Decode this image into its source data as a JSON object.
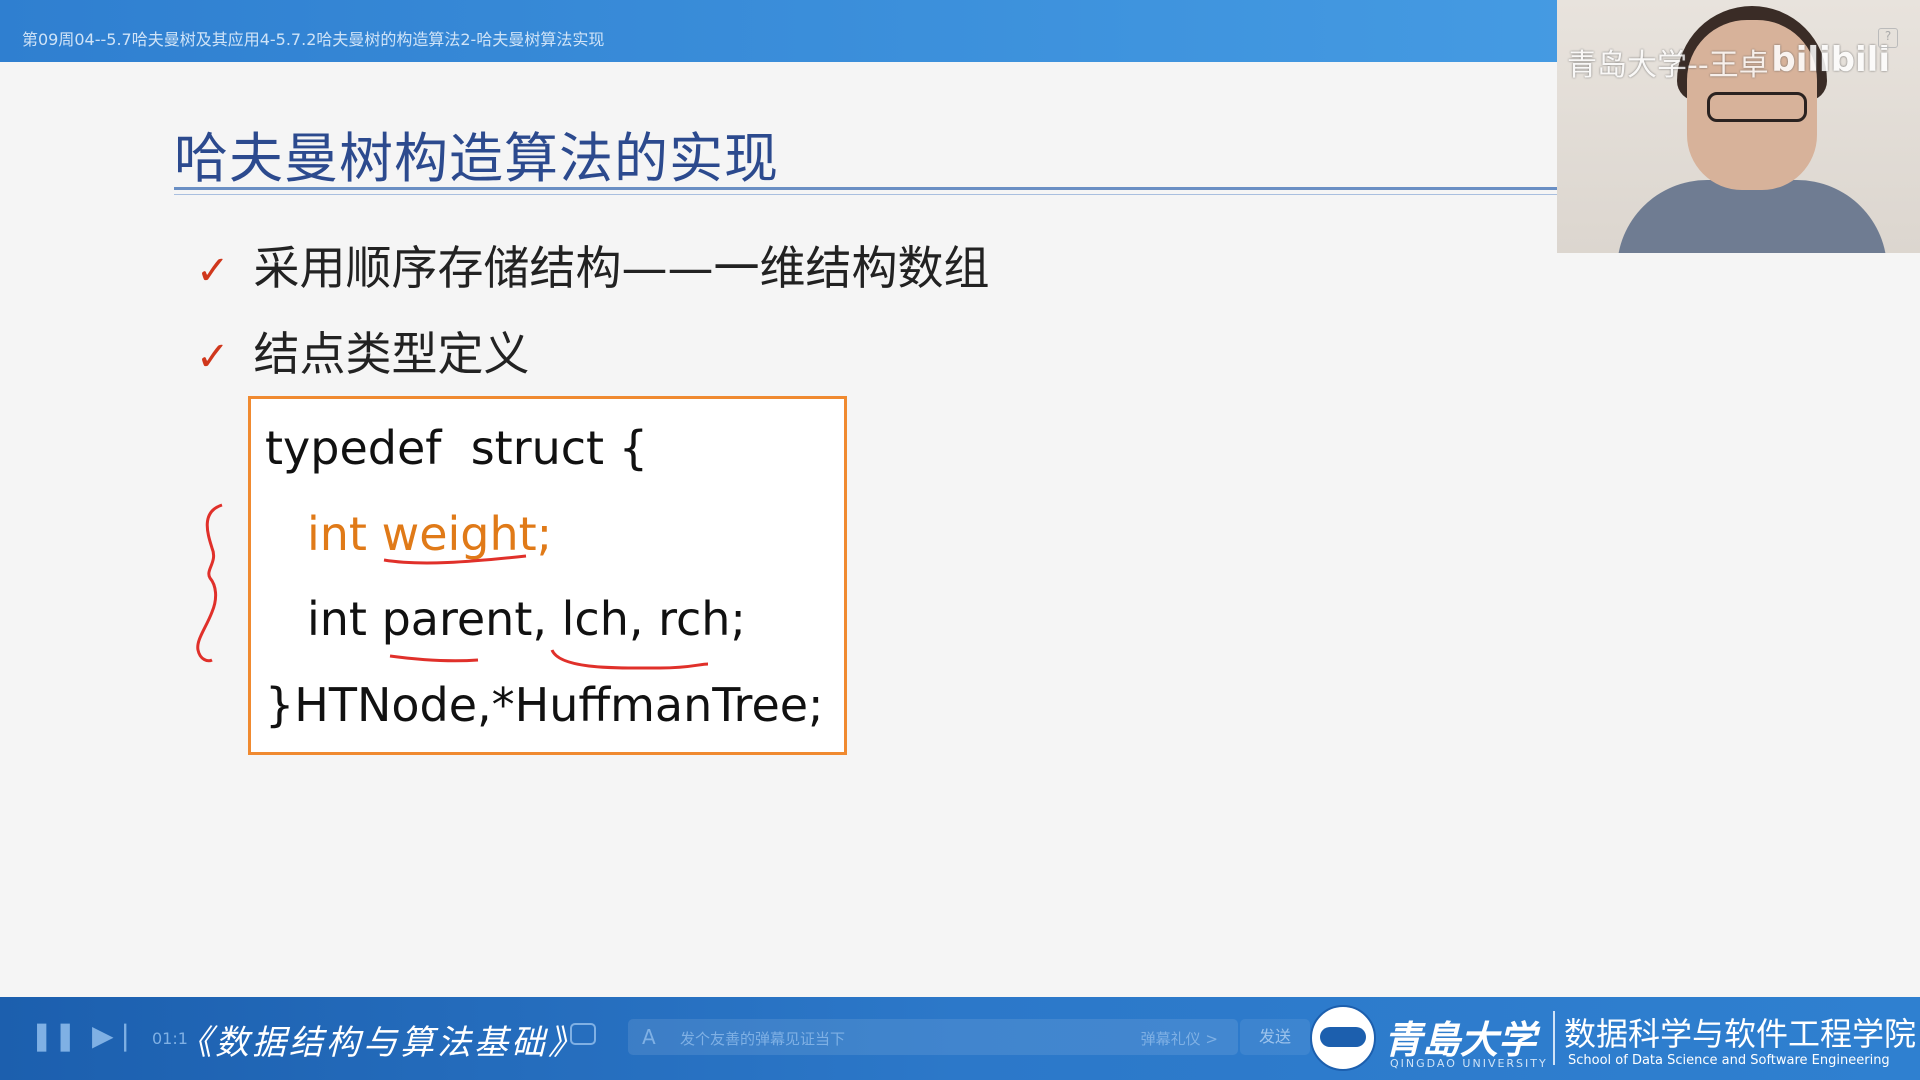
{
  "video": {
    "title": "第09周04--5.7哈夫曼树及其应用4-5.7.2哈夫曼树的构造算法2-哈夫曼树算法实现",
    "current_time": "01:1"
  },
  "slide": {
    "title": "哈夫曼树构造算法的实现",
    "bullets": [
      {
        "check": "✓",
        "text": "采用顺序存储结构——一维结构数组"
      },
      {
        "check": "✓",
        "text": "结点类型定义"
      }
    ],
    "code": [
      "typedef  struct {",
      "int weight;",
      "int parent, lch, rch;",
      "}HTNode,*HuffmanTree;"
    ]
  },
  "webcam": {
    "caption": "青岛大学--王卓",
    "watermark": "bilibili",
    "help": "?"
  },
  "player": {
    "course_title": "《数据结构与算法基础》",
    "danmaku_placeholder": "发个友善的弹幕见证当下",
    "danmaku_etiquette": "弹幕礼仪 >",
    "send_label": "发送"
  },
  "branding": {
    "university_cn": "青島大学",
    "university_en": "QINGDAO UNIVERSITY",
    "school_cn": "数据科学与软件工程学院",
    "school_en": "School of Data Science and Software Engineering"
  },
  "colors": {
    "title_blue": "#2c4a8e",
    "check_red": "#d0371c",
    "code_border_orange": "#f08a30",
    "highlight_orange": "#e07a18",
    "bar_blue": "#2c78c9"
  }
}
